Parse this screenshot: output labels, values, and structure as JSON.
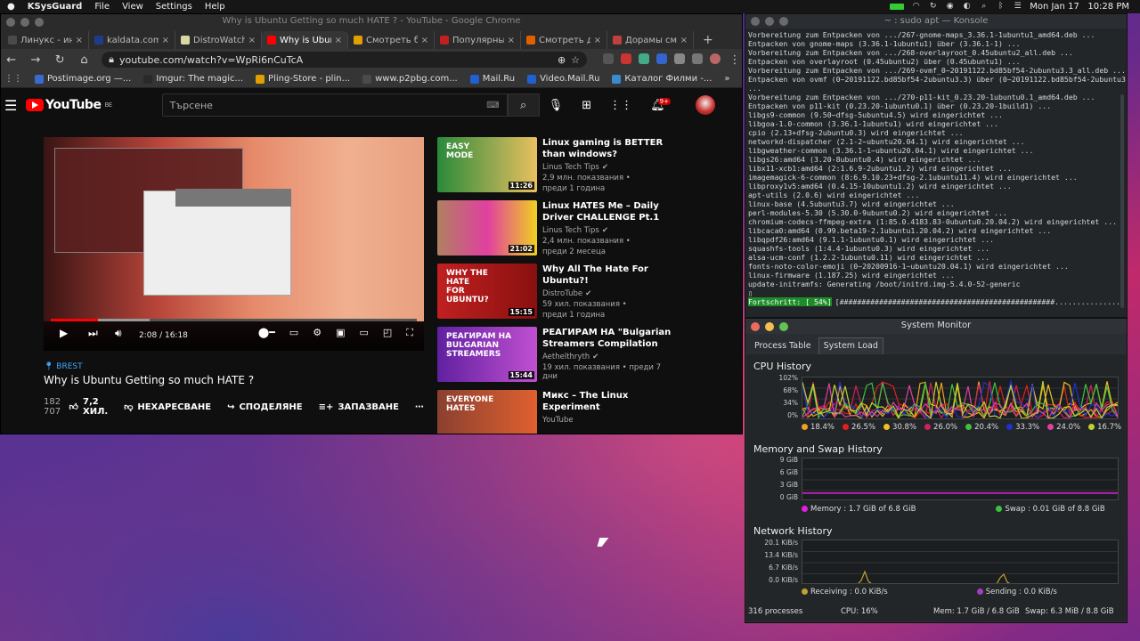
{
  "topbar": {
    "app": "KSysGuard",
    "menus": [
      "File",
      "View",
      "Settings",
      "Help"
    ],
    "clock": "Mon Jan 17   10:28 PM"
  },
  "chrome": {
    "title": "Why is Ubuntu Getting so much HATE ? - YouTube - Google Chrome",
    "tabs": [
      {
        "label": "Линукс - инс",
        "color": "#4a4a4a"
      },
      {
        "label": "kaldata.com",
        "color": "#1e3c8c"
      },
      {
        "label": "DistroWatch",
        "color": "#d8d8a0"
      },
      {
        "label": "Why is Ubunt",
        "color": "#ff0000",
        "active": true
      },
      {
        "label": "Смотреть бе",
        "color": "#e0a000"
      },
      {
        "label": "Популярные",
        "color": "#c02020"
      },
      {
        "label": "Смотреть до",
        "color": "#e06000"
      },
      {
        "label": "Дорамы смо",
        "color": "#c04040"
      }
    ],
    "url": "youtube.com/watch?v=WpRi6nCuTcA",
    "bookmarks": [
      {
        "label": "Postimage.org —...",
        "color": "#3a6ad0"
      },
      {
        "label": "Imgur: The magic...",
        "color": "#2a2a2a"
      },
      {
        "label": "Pling-Store - plin...",
        "color": "#e0a000"
      },
      {
        "label": "www.p2pbg.com...",
        "color": "#4a4a4a"
      },
      {
        "label": "Mail.Ru",
        "color": "#2060d0"
      },
      {
        "label": "Video.Mail.Ru",
        "color": "#2060d0"
      },
      {
        "label": "Каталог Филми -...",
        "color": "#3a8ad0"
      }
    ],
    "other_bookmarks": "Other bookmarks"
  },
  "youtube": {
    "region": "BE",
    "logo": "YouTube",
    "search_placeholder": "Търсене",
    "notif_count": "9+",
    "time": "2:08 / 16:18",
    "progress": 0.13,
    "buffered": 0.27,
    "location": "BREST",
    "title": "Why is Ubuntu Getting so much HATE ?",
    "views": "182 707",
    "likes": "7,2 ХИЛ.",
    "dislike": "НЕХАРЕСВАНЕ",
    "share": "СПОДЕЛЯНЕ",
    "save": "ЗАПАЗВАНЕ",
    "related": [
      {
        "title": "Linux gaming is BETTER than windows?",
        "channel": "Linus Tech Tips",
        "views": "2,9 млн. показвания •",
        "age": "преди 1 година",
        "duration": "11:26",
        "bg": "linear-gradient(90deg,#2a8a3a,#e8c060)",
        "label": "EASY\nMODE"
      },
      {
        "title": "Linux HATES Me – Daily Driver CHALLENGE Pt.1",
        "channel": "Linus Tech Tips",
        "views": "2,4 млн. показвания •",
        "age": "преди 2 месеца",
        "duration": "21:02",
        "bg": "linear-gradient(90deg,#b08060,#e040a0 50%,#f0d020)",
        "label": ""
      },
      {
        "title": "Why All The Hate For Ubuntu?!",
        "channel": "DistroTube",
        "views": "59 хил. показвания •",
        "age": "преди 1 година",
        "duration": "15:15",
        "bg": "linear-gradient(90deg,#c02020,#8a1010)",
        "label": "WHY THE\nHATE\nFOR\nUBUNTU?"
      },
      {
        "title": "РЕАГИРАМ НА \"Bulgarian Streamers Compilation \"Rebor...",
        "channel": "Aethelthryth",
        "views": "19 хил. показвания • преди 7 дни",
        "age": "",
        "duration": "15:44",
        "bg": "linear-gradient(90deg,#6020a0,#c050d0)",
        "label": "РЕАГИРАМ НА\nBULGARIAN\nSTREAMERS"
      },
      {
        "title": "Микс – The Linux Experiment",
        "channel": "YouTube",
        "views": "",
        "age": "",
        "duration": "",
        "bg": "linear-gradient(90deg,#8a4030,#e06030)",
        "label": "EVERYONE\nHATES"
      }
    ]
  },
  "konsole": {
    "title": "~ : sudo apt — Konsole",
    "lines": [
      "Vorbereitung zum Entpacken von .../267-gnome-maps_3.36.1-1ubuntu1_amd64.deb ...",
      "Entpacken von gnome-maps (3.36.1-1ubuntu1) über (3.36.1-1) ...",
      "Vorbereitung zum Entpacken von .../268-overlayroot_0.45ubuntu2_all.deb ...",
      "Entpacken von overlayroot (0.45ubuntu2) über (0.45ubuntu1) ...",
      "Vorbereitung zum Entpacken von .../269-ovmf_0~20191122.bd85bf54-2ubuntu3.3_all.deb ...",
      "Entpacken von ovmf (0~20191122.bd85bf54-2ubuntu3.3) über (0~20191122.bd85bf54-2ubuntu3)",
      "...",
      "Vorbereitung zum Entpacken von .../270-p11-kit_0.23.20-1ubuntu0.1_amd64.deb ...",
      "Entpacken von p11-kit (0.23.20-1ubuntu0.1) über (0.23.20-1build1) ...",
      "libgs9-common (9.50~dfsg-5ubuntu4.5) wird eingerichtet ...",
      "libgoa-1.0-common (3.36.1-1ubuntu1) wird eingerichtet ...",
      "cpio (2.13+dfsg-2ubuntu0.3) wird eingerichtet ...",
      "networkd-dispatcher (2.1-2~ubuntu20.04.1) wird eingerichtet ...",
      "libgweather-common (3.36.1-1~ubuntu20.04.1) wird eingerichtet ...",
      "libgs26:amd64 (3.20-8ubuntu0.4) wird eingerichtet ...",
      "libx11-xcb1:amd64 (2:1.6.9-2ubuntu1.2) wird eingerichtet ...",
      "imagemagick-6-common (8:6.9.10.23+dfsg-2.1ubuntu11.4) wird eingerichtet ...",
      "libproxy1v5:amd64 (0.4.15-10ubuntu1.2) wird eingerichtet ...",
      "apt-utils (2.0.6) wird eingerichtet ...",
      "linux-base (4.5ubuntu3.7) wird eingerichtet ...",
      "perl-modules-5.30 (5.30.0-9ubuntu0.2) wird eingerichtet ...",
      "chromium-codecs-ffmpeg-extra (1:85.0.4183.83-0ubuntu0.20.04.2) wird eingerichtet ...",
      "libcaca0:amd64 (0.99.beta19-2.1ubuntu1.20.04.2) wird eingerichtet ...",
      "libqpdf26:amd64 (9.1.1-1ubuntu0.1) wird eingerichtet ...",
      "squashfs-tools (1:4.4-1ubuntu0.3) wird eingerichtet ...",
      "alsa-ucm-conf (1.2.2-1ubuntu0.11) wird eingerichtet ...",
      "fonts-noto-color-emoji (0~20200916-1~ubuntu20.04.1) wird eingerichtet ...",
      "linux-firmware (1.187.25) wird eingerichtet ...",
      "update-initramfs: Generating /boot/initrd.img-5.4.0-52-generic",
      "▯"
    ],
    "progress_label": "Fortschritt: [ 54%]",
    "progress_bar": "[#################################################.........................................]",
    "progress_pct": 0.54
  },
  "sysmon": {
    "title": "System Monitor",
    "tabs": [
      "Process Table",
      "System Load"
    ],
    "cpu": {
      "title": "CPU History",
      "yticks": [
        "102%",
        "68%",
        "34%",
        "0%"
      ],
      "cores": [
        {
          "label": "18.4%",
          "color": "#f0a020"
        },
        {
          "label": "26.5%",
          "color": "#e02020"
        },
        {
          "label": "30.8%",
          "color": "#f0c020"
        },
        {
          "label": "26.0%",
          "color": "#d02060"
        },
        {
          "label": "20.4%",
          "color": "#40c040"
        },
        {
          "label": "33.3%",
          "color": "#2030d0"
        },
        {
          "label": "24.0%",
          "color": "#e040a0"
        },
        {
          "label": "16.7%",
          "color": "#c0d030"
        }
      ]
    },
    "memory": {
      "title": "Memory and Swap History",
      "yticks": [
        "9 GiB",
        "6 GiB",
        "3 GiB",
        "0 GiB"
      ],
      "mem_label": "Memory : 1.7 GiB of 6.8 GiB",
      "swap_label": "Swap : 0.01 GiB of 8.8 GiB",
      "mem_color": "#e020e0",
      "swap_color": "#40c040",
      "mem_value": 1.7,
      "swap_value": 0.01,
      "ymax": 9
    },
    "network": {
      "title": "Network History",
      "yticks": [
        "20.1 KiB/s",
        "13.4 KiB/s",
        "6.7 KiB/s",
        "0.0 KiB/s"
      ],
      "recv_label": "Receiving : 0.0 KiB/s",
      "send_label": "Sending : 0.0 KiB/s",
      "recv_color": "#c0a030",
      "send_color": "#a040c0"
    },
    "status": {
      "processes": "316 processes",
      "cpu": "CPU: 16%",
      "mem": "Mem: 1.7 GiB / 6.8 GiB",
      "swap": "Swap: 6.3 MiB / 8.8 GiB"
    }
  }
}
